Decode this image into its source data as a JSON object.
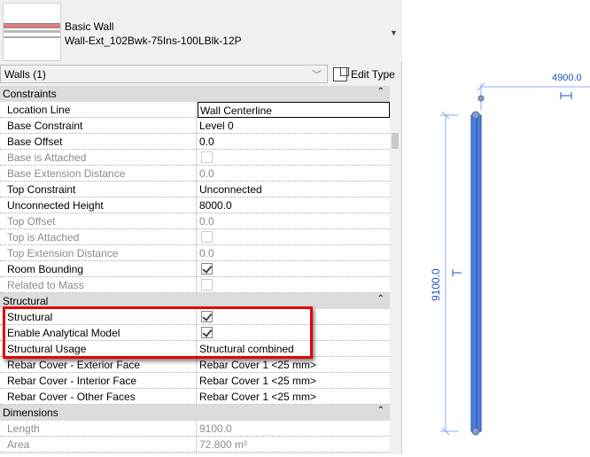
{
  "type_selector": {
    "family": "Basic Wall",
    "type": "Wall-Ext_102Bwk-75Ins-100LBlk-12P"
  },
  "filter": {
    "value": "Walls (1)",
    "edit_type_label": "Edit Type"
  },
  "groups": [
    {
      "name": "Constraints",
      "rows": [
        {
          "label": "Location Line",
          "value": "Wall Centerline",
          "kind": "edit"
        },
        {
          "label": "Base Constraint",
          "value": "Level 0"
        },
        {
          "label": "Base Offset",
          "value": "0.0"
        },
        {
          "label": "Base is Attached",
          "check": false,
          "disabled": true
        },
        {
          "label": "Base Extension Distance",
          "value": "0.0",
          "disabled": true
        },
        {
          "label": "Top Constraint",
          "value": "Unconnected"
        },
        {
          "label": "Unconnected Height",
          "value": "8000.0"
        },
        {
          "label": "Top Offset",
          "value": "0.0",
          "disabled": true
        },
        {
          "label": "Top is Attached",
          "check": false,
          "disabled": true
        },
        {
          "label": "Top Extension Distance",
          "value": "0.0",
          "disabled": true
        },
        {
          "label": "Room Bounding",
          "check": true
        },
        {
          "label": "Related to Mass",
          "check": false,
          "disabled": true
        }
      ]
    },
    {
      "name": "Structural",
      "rows": [
        {
          "label": "Structural",
          "check": true
        },
        {
          "label": "Enable Analytical Model",
          "check": true
        },
        {
          "label": "Structural Usage",
          "value": "Structural combined"
        },
        {
          "label": "Rebar Cover - Exterior Face",
          "value": "Rebar Cover 1 <25 mm>"
        },
        {
          "label": "Rebar Cover - Interior Face",
          "value": "Rebar Cover 1 <25 mm>"
        },
        {
          "label": "Rebar Cover - Other Faces",
          "value": "Rebar Cover 1 <25 mm>"
        }
      ]
    },
    {
      "name": "Dimensions",
      "rows": [
        {
          "label": "Length",
          "value": "9100.0",
          "disabled": true
        },
        {
          "label": "Area",
          "value": "72.800 m²",
          "disabled": true
        }
      ]
    }
  ],
  "view": {
    "dim_horizontal": "4900.0",
    "dim_vertical": "9100.0"
  },
  "colors": {
    "highlight": "#e60000",
    "wall": "#4f7fd6",
    "dim": "#1f4fbf"
  }
}
